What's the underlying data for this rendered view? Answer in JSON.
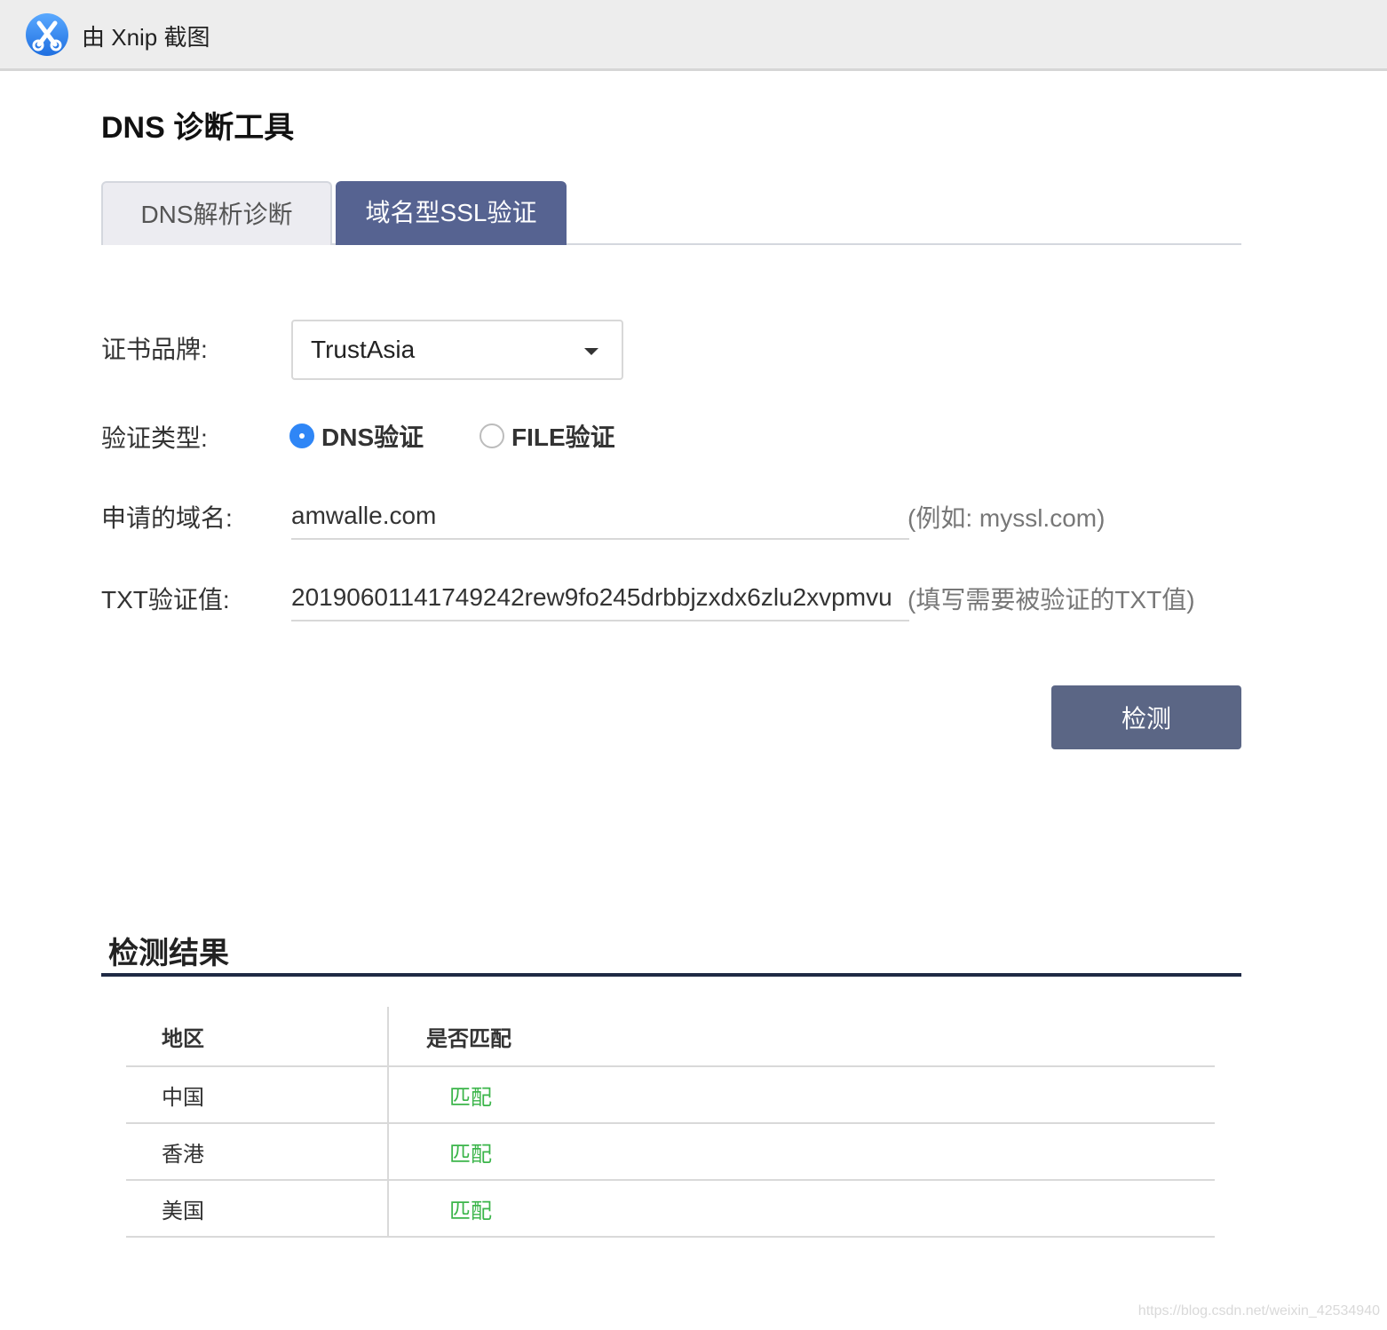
{
  "topbar": {
    "title": "由 Xnip 截图"
  },
  "page": {
    "title": "DNS 诊断工具"
  },
  "tabs": [
    {
      "label": "DNS解析诊断",
      "active": false
    },
    {
      "label": "域名型SSL验证",
      "active": true
    }
  ],
  "form": {
    "brand_label": "证书品牌:",
    "brand_value": "TrustAsia",
    "type_label": "验证类型:",
    "type_options": [
      {
        "label": "DNS验证",
        "checked": true
      },
      {
        "label": "FILE验证",
        "checked": false
      }
    ],
    "domain_label": "申请的域名:",
    "domain_value": "amwalle.com",
    "domain_hint": "(例如: myssl.com)",
    "txt_label": "TXT验证值:",
    "txt_value": "20190601141749242rew9fo245drbbjzxdx6zlu2xvpmvu",
    "txt_hint": "(填写需要被验证的TXT值)",
    "submit_label": "检测"
  },
  "results": {
    "title": "检测结果",
    "columns": [
      "地区",
      "是否匹配"
    ],
    "rows": [
      {
        "region": "中国",
        "match": "匹配"
      },
      {
        "region": "香港",
        "match": "匹配"
      },
      {
        "region": "美国",
        "match": "匹配"
      }
    ],
    "match_color": "#3bb54a"
  },
  "watermark": "https://blog.csdn.net/weixin_42534940"
}
